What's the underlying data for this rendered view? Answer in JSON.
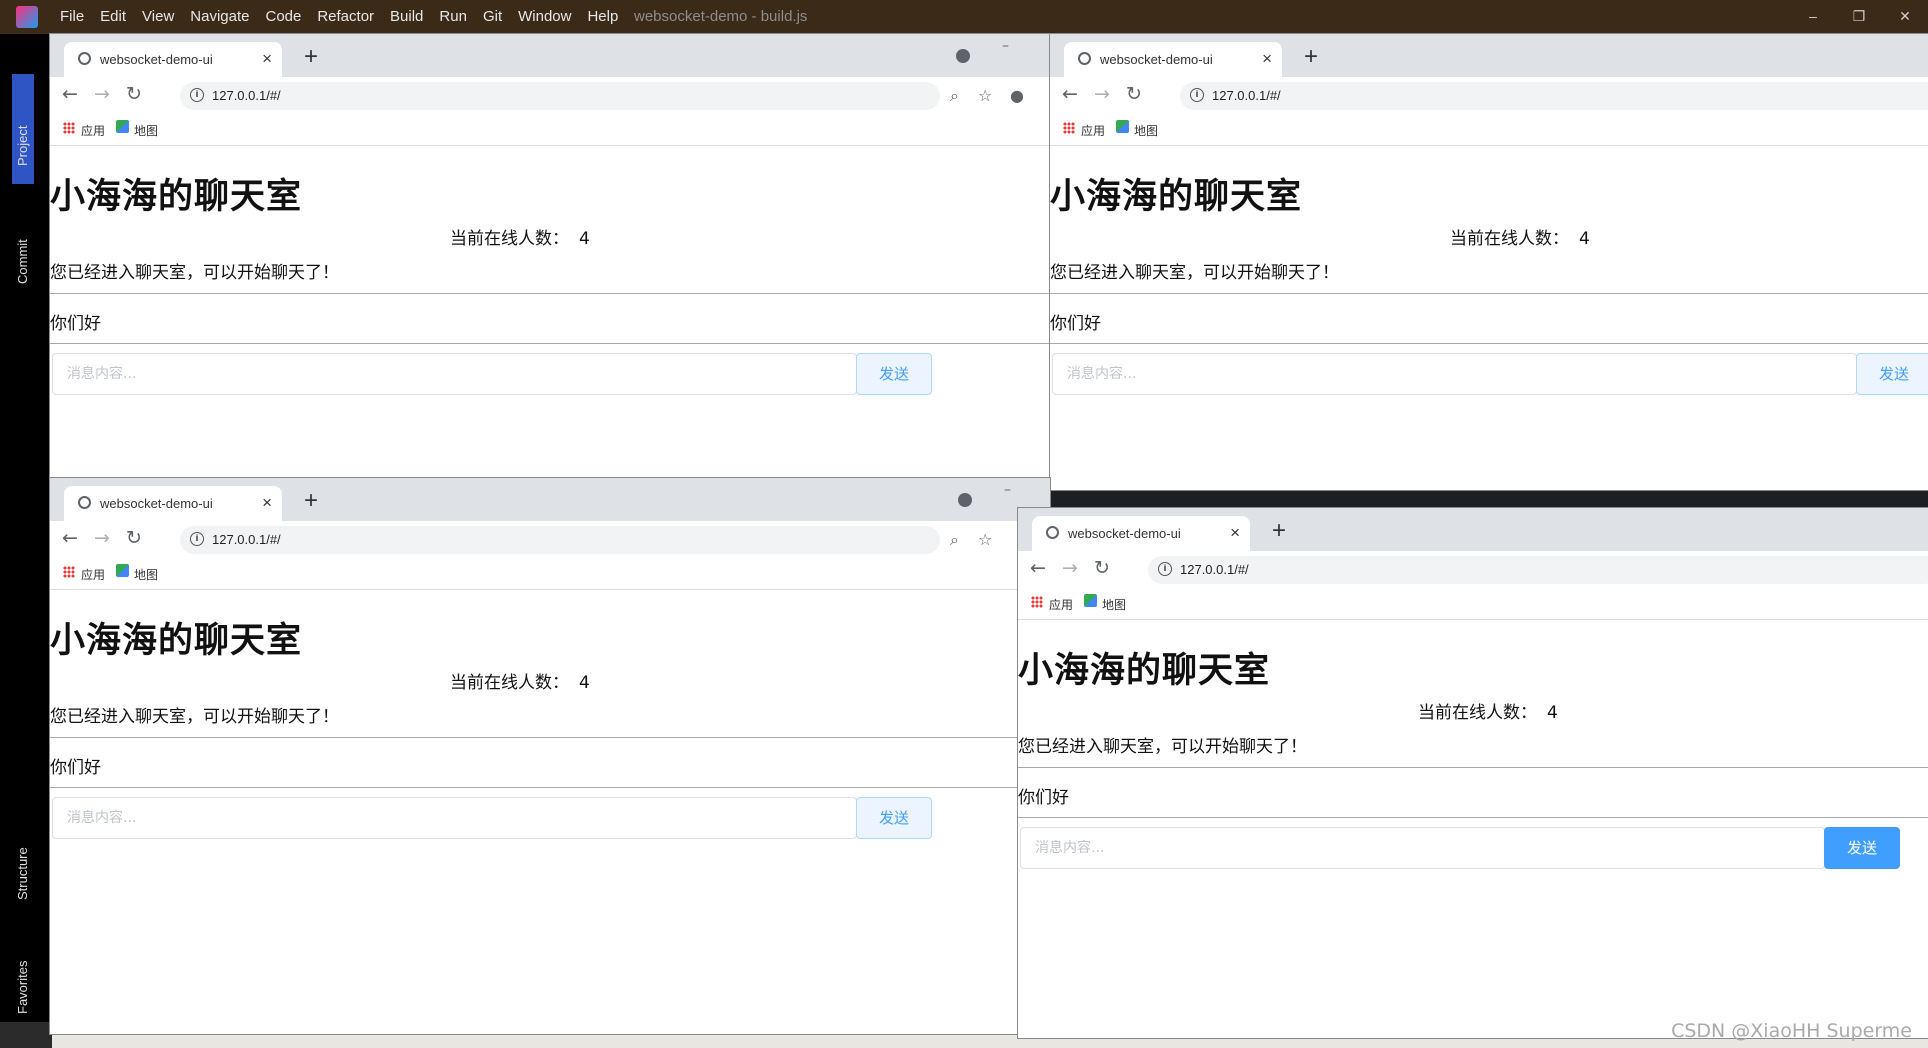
{
  "ide": {
    "menu": [
      "File",
      "Edit",
      "View",
      "Navigate",
      "Code",
      "Refactor",
      "Build",
      "Run",
      "Git",
      "Window",
      "Help"
    ],
    "window_title": "websocket-demo - build.js",
    "side_tabs": [
      "Project",
      "Commit",
      "Structure",
      "Favorites"
    ],
    "controls": {
      "minimize": "–",
      "restore": "❐",
      "close": "✕"
    }
  },
  "browser": {
    "tab_title": "websocket-demo-ui",
    "url": "127.0.0.1/#/",
    "bookmarks": [
      "应用",
      "地图"
    ]
  },
  "chat": {
    "title": "小海海的聊天室",
    "online_label": "当前在线人数：",
    "online_count": "4",
    "system_message": "您已经进入聊天室，可以开始聊天了！",
    "message": "你们好",
    "input_placeholder": "消息内容...",
    "send_label": "发送"
  },
  "colors": {
    "primary": "#409eff",
    "ide_titlebar": "#3b2a17"
  },
  "watermark": "CSDN @XiaoHH Superme"
}
